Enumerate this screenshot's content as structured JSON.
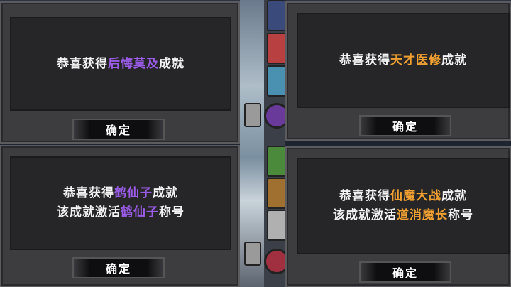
{
  "colors": {
    "purple": "#9b5ce8",
    "orange": "#f0a030",
    "white": "#f2f2f2"
  },
  "dialogs": [
    {
      "id": "top-left",
      "lines": [
        [
          {
            "text": "恭喜获得",
            "color": "white"
          },
          {
            "text": "后悔莫及",
            "color": "purple"
          },
          {
            "text": "成就",
            "color": "white"
          }
        ]
      ],
      "button_label": "确定"
    },
    {
      "id": "top-right",
      "lines": [
        [
          {
            "text": "恭喜获得",
            "color": "white"
          },
          {
            "text": "天才医修",
            "color": "orange"
          },
          {
            "text": "成就",
            "color": "white"
          }
        ]
      ],
      "button_label": "确定"
    },
    {
      "id": "bottom-left",
      "lines": [
        [
          {
            "text": "恭喜获得",
            "color": "white"
          },
          {
            "text": "鹤仙子",
            "color": "purple"
          },
          {
            "text": "成就",
            "color": "white"
          }
        ],
        [
          {
            "text": "该成就激活",
            "color": "white"
          },
          {
            "text": "鹤仙子",
            "color": "purple"
          },
          {
            "text": "称号",
            "color": "white"
          }
        ]
      ],
      "button_label": "确定"
    },
    {
      "id": "bottom-right",
      "lines": [
        [
          {
            "text": "恭喜获得",
            "color": "white"
          },
          {
            "text": "仙魔大战",
            "color": "orange"
          },
          {
            "text": "成就",
            "color": "white"
          }
        ],
        [
          {
            "text": "该成就激活",
            "color": "white"
          },
          {
            "text": "道消魔长",
            "color": "orange"
          },
          {
            "text": "称号",
            "color": "white"
          }
        ]
      ],
      "button_label": "确定"
    }
  ]
}
